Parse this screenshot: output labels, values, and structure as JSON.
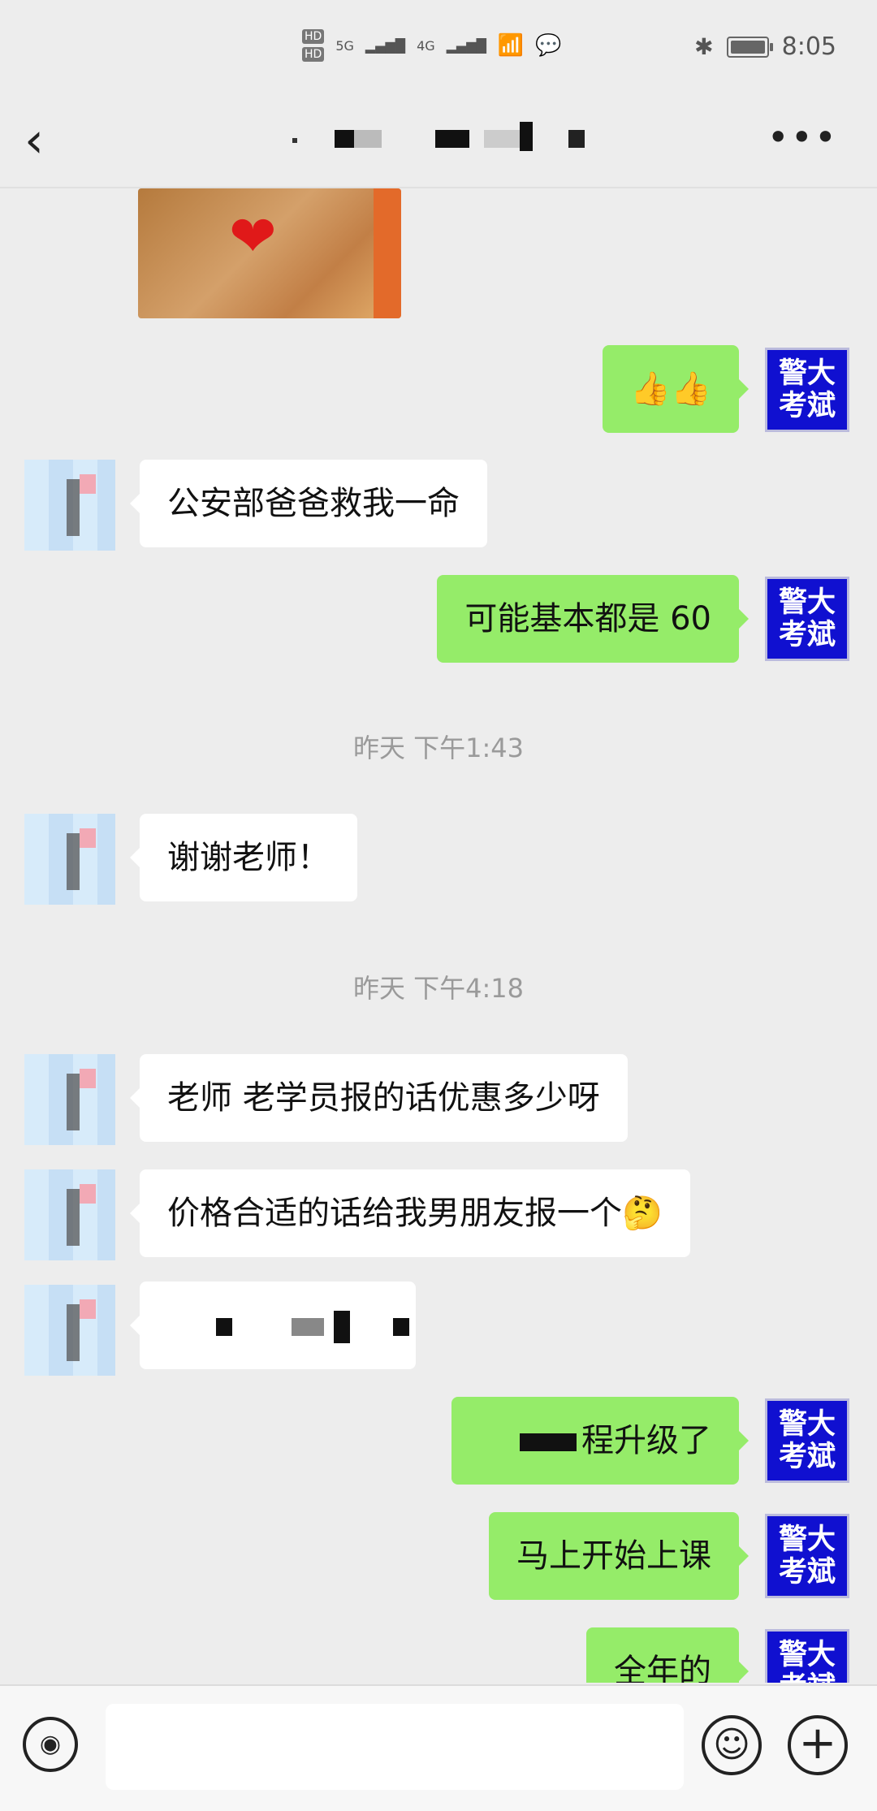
{
  "status_bar": {
    "hd1": "HD",
    "hd2": "HD",
    "network1": "5G",
    "network2": "4G",
    "time": "8:05"
  },
  "nav": {
    "back_icon": "chevron-left-icon",
    "more_icon": "more-icon",
    "more_glyph": "•••"
  },
  "self_avatar_text": "警大考斌",
  "messages": {
    "self_1": "👍👍",
    "other_1": "公安部爸爸救我一命",
    "self_2": "可能基本都是 60",
    "time_1": "昨天 下午1:43",
    "other_2": "谢谢老师！",
    "time_2": "昨天 下午4:18",
    "other_3": "老师 老学员报的话优惠多少呀",
    "other_4": "价格合适的话给我男朋友报一个🤔",
    "self_3": "程升级了",
    "self_4": "马上开始上课",
    "self_5": "全年的"
  },
  "input": {
    "voice_icon": "voice-icon",
    "emoji_icon": "emoji-icon",
    "plus_icon": "plus-icon"
  }
}
